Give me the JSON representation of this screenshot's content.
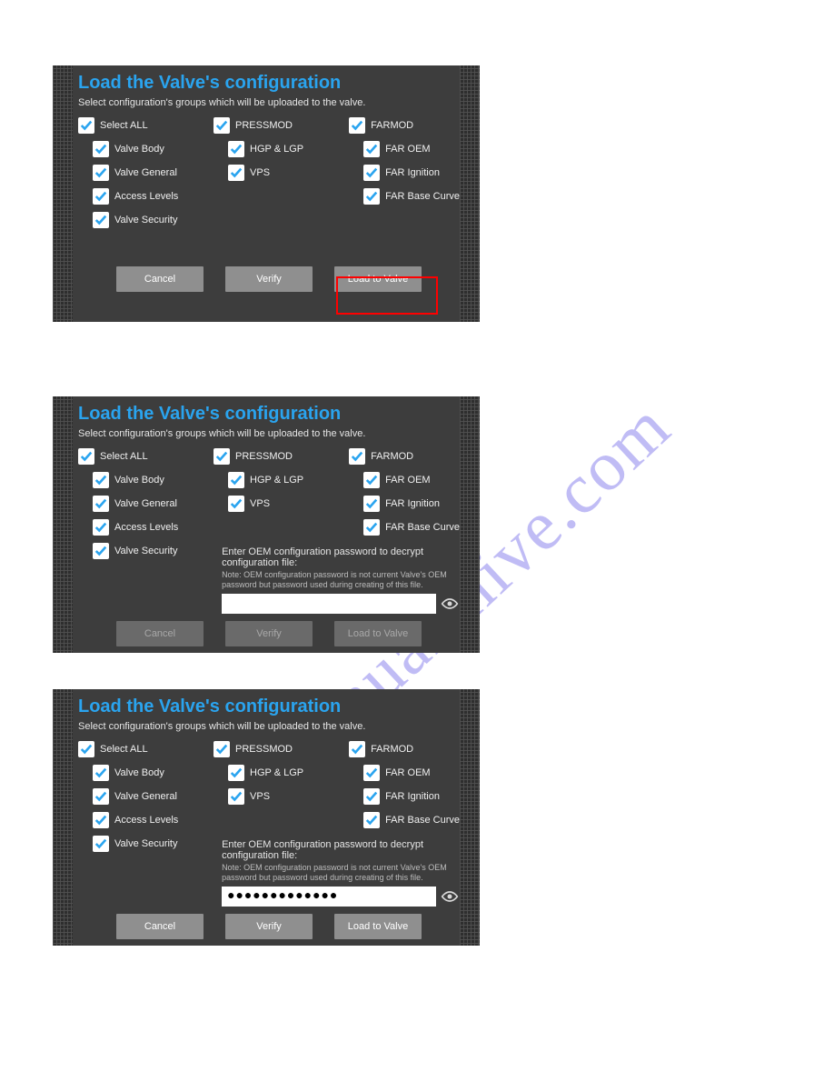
{
  "watermark": "manualshive.com",
  "panel1": {
    "title": "Load the Valve's configuration",
    "subtitle": "Select configuration's groups which will be uploaded to the valve.",
    "col1": {
      "head": "Select ALL",
      "items": [
        "Valve Body",
        "Valve General",
        "Access Levels",
        "Valve Security"
      ]
    },
    "col2": {
      "head": "PRESSMOD",
      "items": [
        "HGP & LGP",
        "VPS"
      ]
    },
    "col3": {
      "head": "FARMOD",
      "items": [
        "FAR OEM",
        "FAR Ignition",
        "FAR Base Curve"
      ]
    },
    "buttons": {
      "cancel": "Cancel",
      "verify": "Verify",
      "load": "Load to Valve"
    }
  },
  "panel2": {
    "title": "Load the Valve's configuration",
    "subtitle": "Select configuration's groups which will be uploaded to the valve.",
    "col1": {
      "head": "Select ALL",
      "items": [
        "Valve Body",
        "Valve General",
        "Access Levels",
        "Valve Security"
      ]
    },
    "col2": {
      "head": "PRESSMOD",
      "items": [
        "HGP & LGP",
        "VPS"
      ]
    },
    "col3": {
      "head": "FARMOD",
      "items": [
        "FAR OEM",
        "FAR Ignition",
        "FAR Base Curve"
      ]
    },
    "pwd": {
      "prompt": "Enter OEM configuration password to decrypt configuration file:",
      "note": "Note: OEM configuration password is not current Valve's OEM password but password used during creating of this file.",
      "value": ""
    },
    "buttons": {
      "cancel": "Cancel",
      "verify": "Verify",
      "load": "Load to Valve"
    }
  },
  "panel3": {
    "title": "Load the Valve's configuration",
    "subtitle": "Select configuration's groups which will be uploaded to the valve.",
    "col1": {
      "head": "Select ALL",
      "items": [
        "Valve Body",
        "Valve General",
        "Access Levels",
        "Valve Security"
      ]
    },
    "col2": {
      "head": "PRESSMOD",
      "items": [
        "HGP & LGP",
        "VPS"
      ]
    },
    "col3": {
      "head": "FARMOD",
      "items": [
        "FAR OEM",
        "FAR Ignition",
        "FAR Base Curve"
      ]
    },
    "pwd": {
      "prompt": "Enter OEM configuration password to decrypt configuration file:",
      "note": "Note: OEM configuration password is not current Valve's OEM password but password used during creating of this file.",
      "value": "●●●●●●●●●●●●●"
    },
    "buttons": {
      "cancel": "Cancel",
      "verify": "Verify",
      "load": "Load to Valve"
    }
  }
}
